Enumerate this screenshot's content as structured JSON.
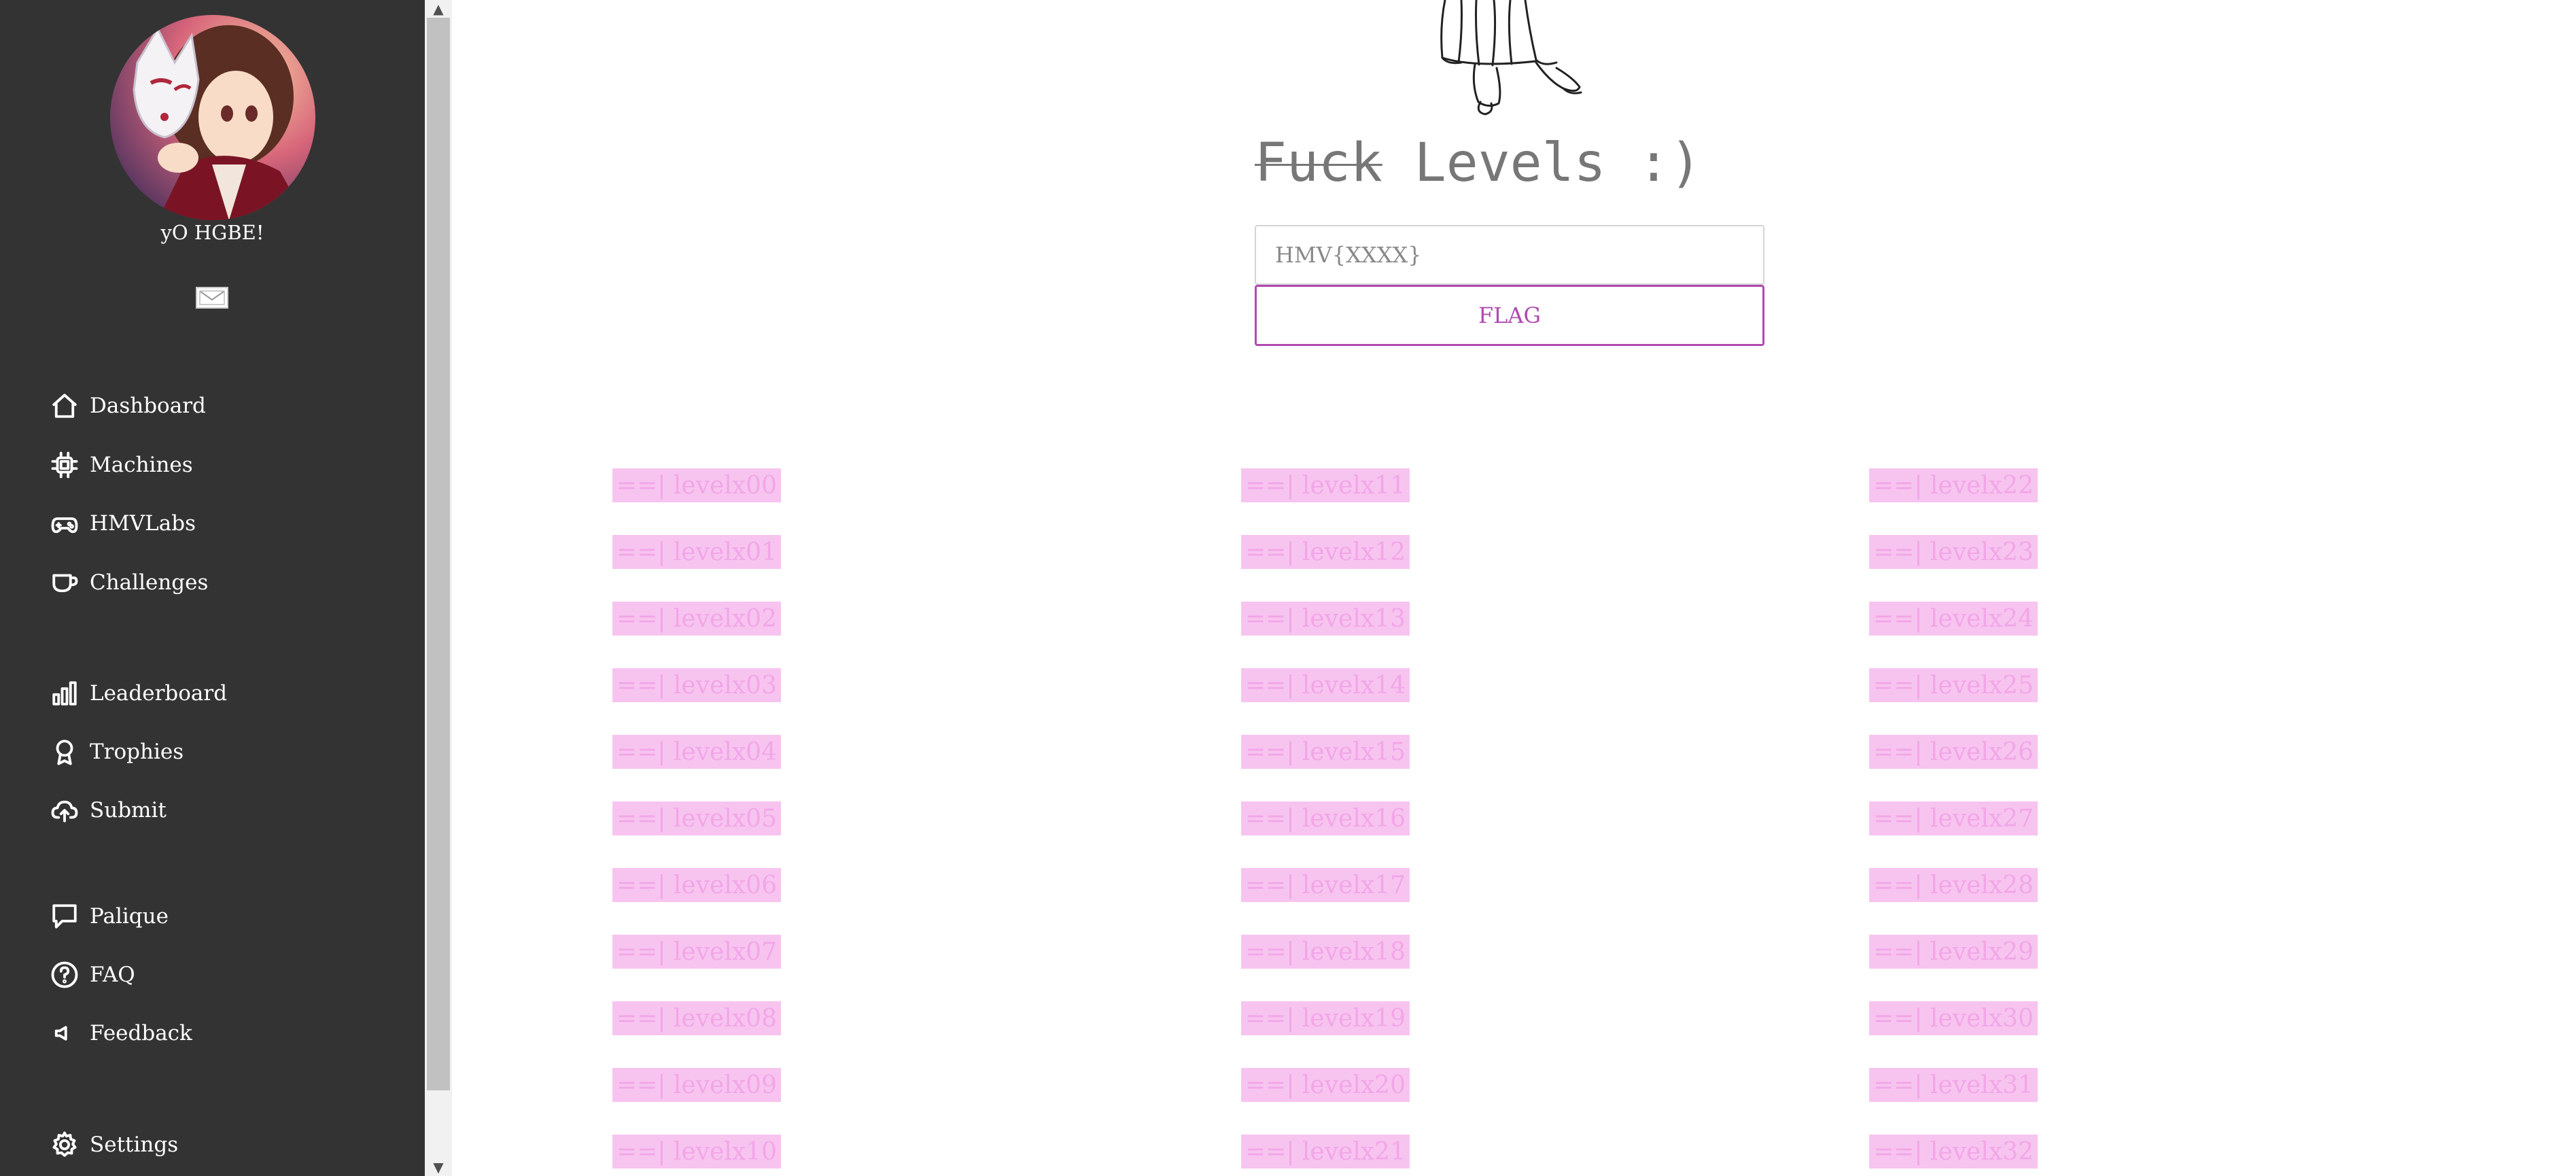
{
  "sidebar": {
    "username": "yO HGBE!",
    "nav_groups": [
      [
        {
          "label": "Dashboard",
          "icon": "home-icon"
        },
        {
          "label": "Machines",
          "icon": "cpu-icon"
        },
        {
          "label": "HMVLabs",
          "icon": "gamepad-icon"
        },
        {
          "label": "Challenges",
          "icon": "cup-icon"
        }
      ],
      [
        {
          "label": "Leaderboard",
          "icon": "bar-chart-icon"
        },
        {
          "label": "Trophies",
          "icon": "trophy-icon"
        },
        {
          "label": "Submit",
          "icon": "cloud-upload-icon"
        }
      ],
      [
        {
          "label": "Palique",
          "icon": "chat-icon"
        },
        {
          "label": "FAQ",
          "icon": "help-icon"
        },
        {
          "label": "Feedback",
          "icon": "megaphone-icon"
        }
      ],
      [
        {
          "label": "Settings",
          "icon": "gear-icon"
        }
      ]
    ]
  },
  "main": {
    "heading_struck": "Fuck",
    "heading_rest": " Levels :)",
    "flag_input_placeholder": "HMV{XXXX}",
    "flag_button_label": "FLAG",
    "levels": [
      [
        "==| levelx00",
        "==| levelx01",
        "==| levelx02",
        "==| levelx03",
        "==| levelx04",
        "==| levelx05",
        "==| levelx06",
        "==| levelx07",
        "==| levelx08",
        "==| levelx09",
        "==| levelx10"
      ],
      [
        "==| levelx11",
        "==| levelx12",
        "==| levelx13",
        "==| levelx14",
        "==| levelx15",
        "==| levelx16",
        "==| levelx17",
        "==| levelx18",
        "==| levelx19",
        "==| levelx20",
        "==| levelx21"
      ],
      [
        "==| levelx22",
        "==| levelx23",
        "==| levelx24",
        "==| levelx25",
        "==| levelx26",
        "==| levelx27",
        "==| levelx28",
        "==| levelx29",
        "==| levelx30",
        "==| levelx31",
        "==| levelx32"
      ]
    ]
  },
  "colors": {
    "sidebar_bg": "#333333",
    "accent": "#b04ab0",
    "level_bg": "#f7c4f0",
    "level_text": "#f2a6e7"
  }
}
